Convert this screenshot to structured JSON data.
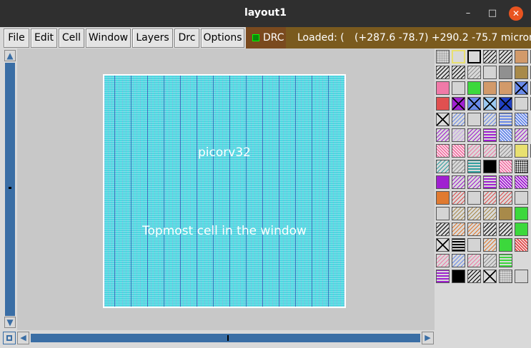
{
  "window": {
    "title": "layout1",
    "minimize": "–",
    "maximize": "□",
    "close": "✕"
  },
  "menubar": {
    "items": [
      {
        "label": "File"
      },
      {
        "label": "Edit"
      },
      {
        "label": "Cell"
      },
      {
        "label": "Window"
      },
      {
        "label": "Layers"
      },
      {
        "label": "Drc"
      },
      {
        "label": "Options"
      }
    ],
    "drc_label": "DRC",
    "drc_color": "#0a8a0a"
  },
  "status": {
    "loaded": "Loaded: (",
    "coords": "(+287.6 -78.7) +290.2 -75.7 microns"
  },
  "canvas": {
    "cell_name": "picorv32",
    "cell_description": "Topmost cell in the window",
    "background_color": "#c8c8c8",
    "cell_color": "#4cd8e0"
  },
  "scroll": {
    "up": "▲",
    "down": "▼",
    "left": "◀",
    "right": "▶"
  },
  "palette": {
    "rows": [
      [
        "dots-gray",
        "outline-yellow",
        "outline-black",
        "hatch-black",
        "hatch-black",
        "solid-tan",
        "hatch-black"
      ],
      [
        "hatch-black",
        "hatch-black",
        "hatch-gray",
        "solid-lightgray",
        "solid-gray",
        "solid-olive",
        "hatch-black"
      ],
      [
        "solid-pink",
        "solid-lightgray",
        "solid-green",
        "solid-tan",
        "solid-tan",
        "x-blue",
        "x-black"
      ],
      [
        "solid-red",
        "x-purple",
        "x-blue",
        "x-lightblue",
        "x-darkblue",
        "solid-lightgray",
        "solid-lightgray"
      ],
      [
        "x-black",
        "hatch-blue",
        "solid-lightgray",
        "hatch-blue",
        "stripe-blue",
        "pattern-blue",
        ""
      ],
      [
        "hatch-purple",
        "hatch-lavender",
        "hatch-purple",
        "stripe-purple",
        "pattern-blue",
        "hatch-purple",
        ""
      ],
      [
        "pattern-pink",
        "pattern-pink",
        "hatch-pink",
        "hatch-pink",
        "hatch-gray",
        "solid-yellow",
        "solid-black"
      ],
      [
        "hatch-teal",
        "hatch-gray",
        "stripe-teal",
        "solid-black",
        "pattern-pink",
        "dots-black",
        ""
      ],
      [
        "solid-purple",
        "hatch-purple",
        "hatch-purple",
        "stripe-purple",
        "pattern-purple",
        "pattern-purple",
        ""
      ],
      [
        "solid-orange",
        "hatch-red",
        "solid-lightgray",
        "hatch-red",
        "hatch-red",
        "solid-lightgray",
        ""
      ],
      [
        "solid-lightgray",
        "hatch-olive",
        "hatch-olive",
        "hatch-olive",
        "solid-olive",
        "solid-green",
        ""
      ],
      [
        "hatch-black",
        "hatch-orange",
        "hatch-orange",
        "hatch-black",
        "hatch-black",
        "solid-green",
        ""
      ],
      [
        "x-black",
        "stripe-black",
        "solid-lightgray",
        "hatch-orange",
        "solid-green",
        "pattern-red",
        ""
      ],
      [
        "hatch-pink",
        "hatch-blue",
        "hatch-pink",
        "hatch-gray",
        "stripe-green",
        "",
        ""
      ],
      [
        "stripe-purple",
        "solid-black",
        "hatch-black",
        "x-black",
        "dots-gray",
        "solid-lightgray",
        ""
      ]
    ]
  }
}
